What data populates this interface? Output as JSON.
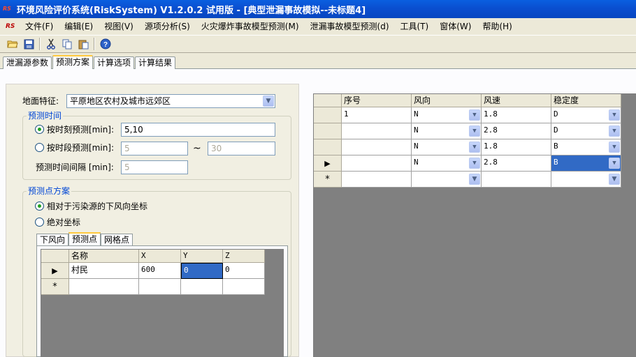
{
  "window": {
    "title": "环境风险评价系统(RiskSystem) V1.2.0.2 试用版 - [典型泄漏事故模拟--未标题4]",
    "logo": "RS"
  },
  "menu": [
    "文件(F)",
    "编辑(E)",
    "视图(V)",
    "源项分析(S)",
    "火灾爆炸事故模型预测(M)",
    "泄漏事故模型预测(d)",
    "工具(T)",
    "窗体(W)",
    "帮助(H)"
  ],
  "toolbar": {
    "icons": [
      "open-folder-icon",
      "save-icon",
      "cut-icon",
      "copy-icon",
      "paste-icon",
      "help-icon"
    ]
  },
  "tabs": [
    "泄漏源参数",
    "预测方案",
    "计算选项",
    "计算结果"
  ],
  "active_tab": 1,
  "left": {
    "ground_label": "地面特征:",
    "ground_value": "平原地区农村及城市远郊区",
    "time_group": "预测时间",
    "radio_by_time": "按时刻预测[min]:",
    "by_time_value": "5,10",
    "radio_by_period": "按时段预测[min]:",
    "period_from": "5",
    "period_sep": "~",
    "period_to": "30",
    "interval_label": "预测时间间隔 [min]:",
    "interval_value": "5",
    "point_group": "预测点方案",
    "radio_relative": "相对于污染源的下风向坐标",
    "radio_absolute": "绝对坐标",
    "inner_tabs": [
      "下风向",
      "预测点",
      "网格点"
    ],
    "inner_active": 1,
    "grid_headers": [
      "名称",
      "X",
      "Y",
      "Z"
    ],
    "grid_rows": [
      [
        "村民",
        "600",
        "0",
        "0"
      ]
    ],
    "new_row_marker": "*",
    "current_row_marker": "▶"
  },
  "right": {
    "headers": [
      "序号",
      "风向",
      "风速",
      "稳定度"
    ],
    "rows": [
      [
        "1",
        "N",
        "1.8",
        "D"
      ],
      [
        "",
        "N",
        "2.8",
        "D"
      ],
      [
        "",
        "N",
        "1.8",
        "B"
      ],
      [
        "",
        "N",
        "2.8",
        "B"
      ]
    ],
    "new_row_marker": "*",
    "current_row_marker": "▶",
    "current_row_index": 3
  },
  "colors": {
    "titlebar": "#0a5fe0",
    "selection": "#316ac5",
    "group_title": "#0046d5",
    "tab_highlight": "#ffc83c"
  }
}
